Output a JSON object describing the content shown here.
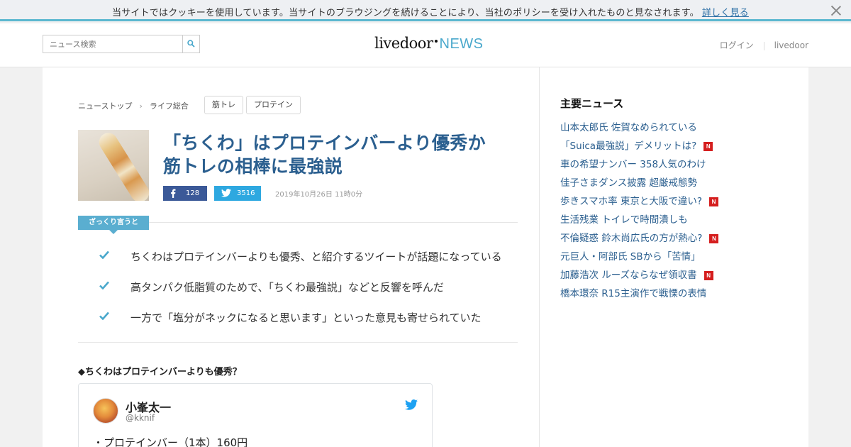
{
  "cookie_bar": {
    "text": "当サイトではクッキーを使用しています。当サイトのブラウジングを続けることにより、当社のポリシーを受け入れたものと見なされます。",
    "link": "詳しく見る"
  },
  "header": {
    "search_placeholder": "ニュース検索",
    "logo_main": "livedoor",
    "logo_news": "NEWS",
    "login": "ログイン",
    "livedoor": "livedoor"
  },
  "breadcrumb": [
    "ニューストップ",
    "ライフ総合"
  ],
  "tags": [
    "筋トレ",
    "プロテイン"
  ],
  "article": {
    "title_line1": "「ちくわ」はプロテインバーより優秀か",
    "title_line2": "筋トレの相棒に最強説",
    "facebook_count": "128",
    "twitter_count": "3516",
    "date": "2019年10月26日 11時0分",
    "summary_label": "ざっくり言うと",
    "summary_points": [
      "ちくわはプロテインバーよりも優秀、と紹介するツイートが話題になっている",
      "高タンパク低脂質のためで、「ちくわ最強説」などと反響を呼んだ",
      "一方で「塩分がネックになると思います」といった意見も寄せられていた"
    ],
    "subheading": "◆ちくわはプロテインバーよりも優秀？"
  },
  "tweet": {
    "name": "小峯太一",
    "handle": "@kknif",
    "text": "・プロテインバー（1本）160円"
  },
  "sidebar": {
    "title": "主要ニュース",
    "items": [
      {
        "text": "山本太郎氏 佐賀なめられている",
        "new": false
      },
      {
        "text": "「Suica最強説」デメリットは?",
        "new": true
      },
      {
        "text": "車の希望ナンバー 358人気のわけ",
        "new": false
      },
      {
        "text": "佳子さまダンス披露 超厳戒態勢",
        "new": false
      },
      {
        "text": "歩きスマホ率 東京と大阪で違い?",
        "new": true
      },
      {
        "text": "生活残業 トイレで時間潰しも",
        "new": false
      },
      {
        "text": "不倫疑惑 鈴木尚広氏の方が熱心?",
        "new": true
      },
      {
        "text": "元巨人・阿部氏 SBから「苦情」",
        "new": false
      },
      {
        "text": "加藤浩次 ルーズならなぜ領収書",
        "new": true
      },
      {
        "text": "橋本環奈 R15主演作で戦慄の表情",
        "new": false
      }
    ],
    "new_badge": "N"
  },
  "colors": {
    "accent": "#5aaed0",
    "title_blue": "#2b5f8f",
    "facebook": "#3b5998",
    "twitter": "#2ea8e0",
    "new_badge": "#d51e1e"
  }
}
